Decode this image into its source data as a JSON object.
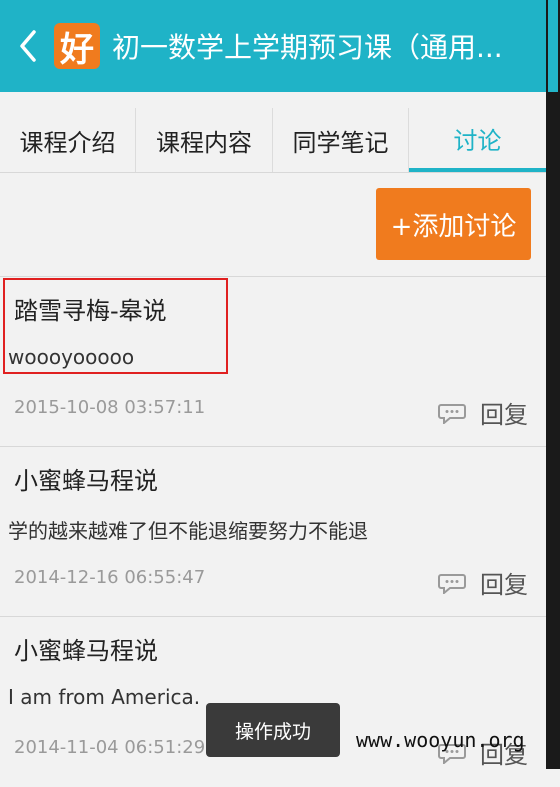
{
  "header": {
    "logo_text": "好",
    "title": "初一数学上学期预习课（通用..."
  },
  "tabs": [
    {
      "label": "课程介绍"
    },
    {
      "label": "课程内容"
    },
    {
      "label": "同学笔记"
    },
    {
      "label": "讨论"
    }
  ],
  "actions": {
    "add_discussion": "+添加讨论"
  },
  "posts": [
    {
      "author": "踏雪寻梅-皋说",
      "content": "woooyooooo",
      "time": "2015-10-08 03:57:11",
      "reply": "回复"
    },
    {
      "author": "小蜜蜂马程说",
      "content": "学的越来越难了但不能退缩要努力不能退",
      "time": "2014-12-16 06:55:47",
      "reply": "回复"
    },
    {
      "author": "小蜜蜂马程说",
      "content": "I am from America.",
      "time": "2014-11-04 06:51:29",
      "reply": "回复"
    }
  ],
  "toast": "操作成功",
  "watermark": "www.wooyun.org",
  "colors": {
    "accent": "#1fb3c7",
    "button": "#f07b1e",
    "highlight": "#e02020"
  }
}
